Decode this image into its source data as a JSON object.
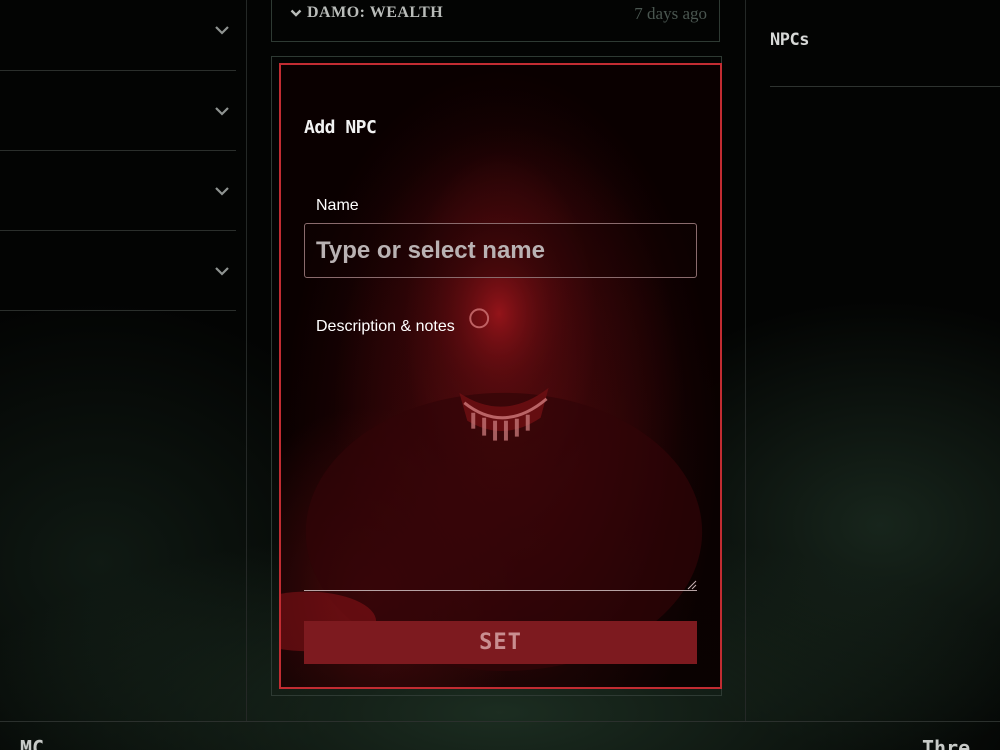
{
  "left_panel": {
    "accordion_items": [
      {
        "expanded": false
      },
      {
        "expanded": false
      },
      {
        "expanded": false
      },
      {
        "expanded": false
      }
    ]
  },
  "news_card": {
    "title": "DAMO: WEALTH",
    "timestamp": "7 days ago",
    "icon": "chevron-down-icon"
  },
  "modal": {
    "title": "Add NPC",
    "name_label": "Name",
    "name_placeholder": "Type or select name",
    "name_value": "",
    "description_label": "Description & notes",
    "description_value": "",
    "submit_label": "SET",
    "border_color": "#c22c32",
    "button_color": "#7d1a1f"
  },
  "right_panel": {
    "title": "NPCs"
  },
  "bottom_bar": {
    "left_text": "MC",
    "right_text": "Thre"
  }
}
